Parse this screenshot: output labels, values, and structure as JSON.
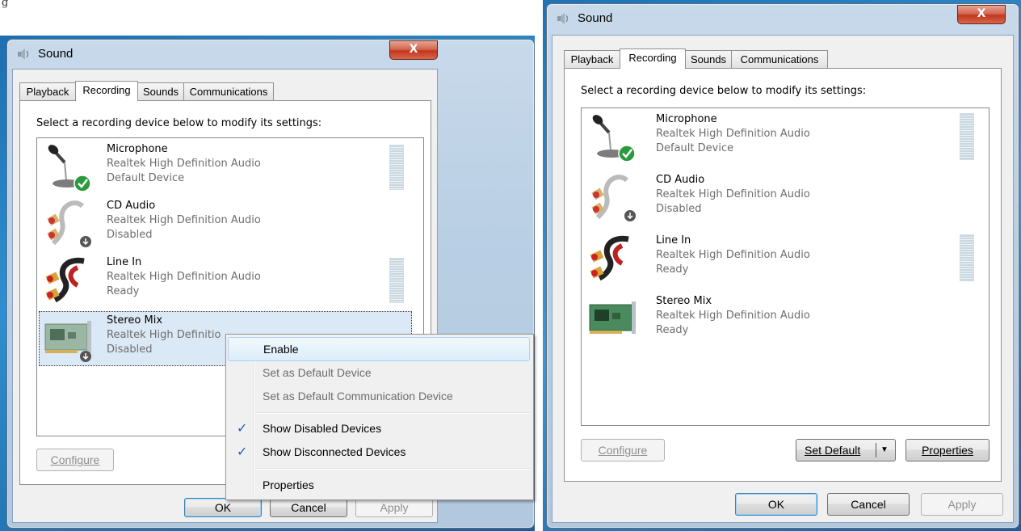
{
  "corner_text": "g",
  "left_window": {
    "title": "Sound",
    "close_label": "X",
    "tabs": [
      "Playback",
      "Recording",
      "Sounds",
      "Communications"
    ],
    "active_tab": "Recording",
    "instruction": "Select a recording device below to modify its settings:",
    "devices": [
      {
        "name": "Microphone",
        "driver": "Realtek High Definition Audio",
        "status": "Default Device",
        "icon": "microphone-icon",
        "meter": true
      },
      {
        "name": "CD Audio",
        "driver": "Realtek High Definition Audio",
        "status": "Disabled",
        "icon": "cd-audio-cable-icon",
        "meter": false
      },
      {
        "name": "Line In",
        "driver": "Realtek High Definition Audio",
        "status": "Ready",
        "icon": "line-in-cable-icon",
        "meter": true
      },
      {
        "name": "Stereo Mix",
        "driver": "Realtek High Definitio",
        "status": "Disabled",
        "icon": "sound-card-icon",
        "meter": false
      }
    ],
    "configure_label": "Configure",
    "ok_label": "OK",
    "cancel_label": "Cancel",
    "apply_label": "Apply",
    "context_menu": {
      "items": [
        {
          "label": "Enable",
          "enabled": true,
          "checked": false,
          "highlighted": true
        },
        {
          "label": "Set as Default Device",
          "enabled": false,
          "checked": false
        },
        {
          "label": "Set as Default Communication Device",
          "enabled": false,
          "checked": false
        },
        {
          "label": "Show Disabled Devices",
          "enabled": true,
          "checked": true
        },
        {
          "label": "Show Disconnected Devices",
          "enabled": true,
          "checked": true
        },
        {
          "label": "Properties",
          "enabled": true,
          "checked": false
        }
      ],
      "check_glyph": "✓"
    }
  },
  "right_window": {
    "title": "Sound",
    "close_label": "X",
    "tabs": [
      "Playback",
      "Recording",
      "Sounds",
      "Communications"
    ],
    "active_tab": "Recording",
    "instruction": "Select a recording device below to modify its settings:",
    "devices": [
      {
        "name": "Microphone",
        "driver": "Realtek High Definition Audio",
        "status": "Default Device",
        "icon": "microphone-icon",
        "meter": true
      },
      {
        "name": "CD Audio",
        "driver": "Realtek High Definition Audio",
        "status": "Disabled",
        "icon": "cd-audio-cable-icon",
        "meter": false
      },
      {
        "name": "Line In",
        "driver": "Realtek High Definition Audio",
        "status": "Ready",
        "icon": "line-in-cable-icon",
        "meter": true
      },
      {
        "name": "Stereo Mix",
        "driver": "Realtek High Definition Audio",
        "status": "Ready",
        "icon": "sound-card-icon",
        "meter": false
      }
    ],
    "configure_label": "Configure",
    "set_default_label": "Set Default",
    "properties_label": "Properties",
    "ok_label": "OK",
    "cancel_label": "Cancel",
    "apply_label": "Apply"
  }
}
